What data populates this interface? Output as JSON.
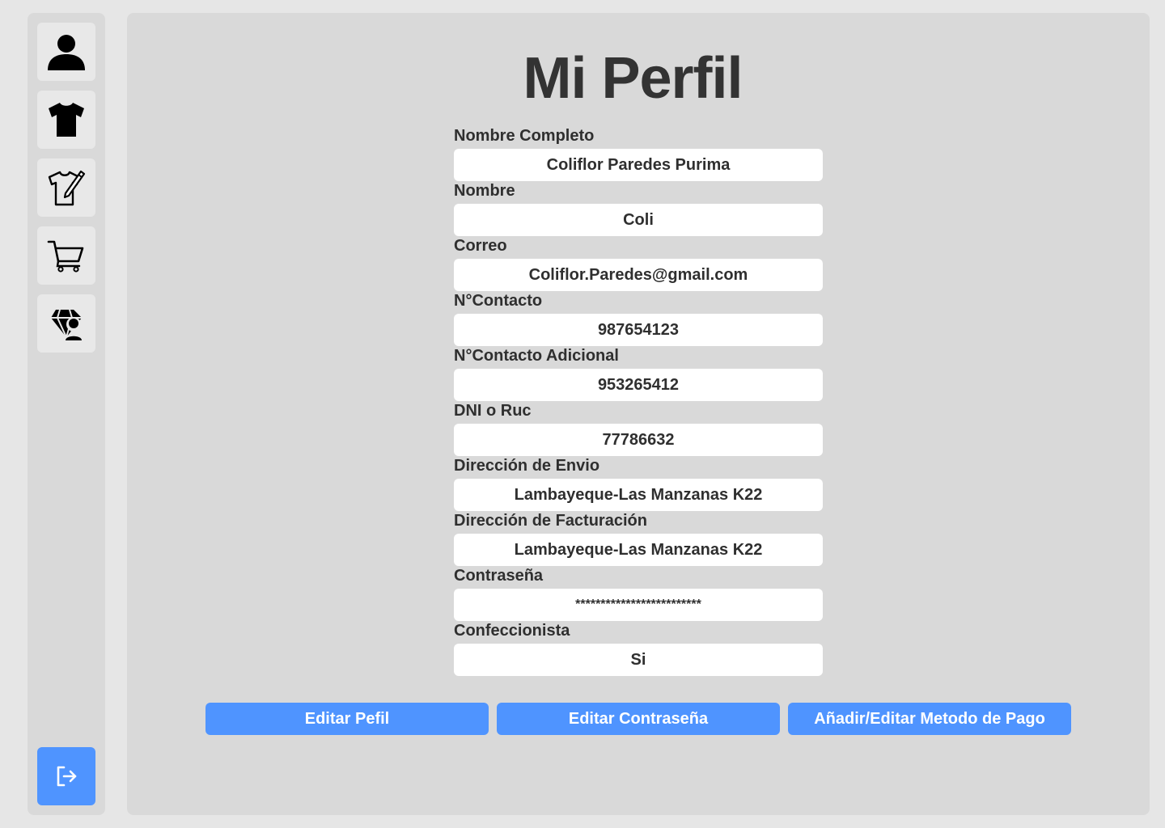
{
  "sidebar": {
    "items": [
      {
        "icon": "user-icon"
      },
      {
        "icon": "tshirt-icon"
      },
      {
        "icon": "tshirt-design-icon"
      },
      {
        "icon": "cart-icon"
      },
      {
        "icon": "diamond-user-icon"
      }
    ],
    "logout_icon": "logout-icon"
  },
  "title": "Mi Perfil",
  "fields": [
    {
      "label": "Nombre Completo",
      "value": "Coliflor Paredes Purima"
    },
    {
      "label": "Nombre",
      "value": "Coli"
    },
    {
      "label": "Correo",
      "value": "Coliflor.Paredes@gmail.com"
    },
    {
      "label": "N°Contacto",
      "value": "987654123"
    },
    {
      "label": "N°Contacto Adicional",
      "value": "953265412"
    },
    {
      "label": "DNI o Ruc",
      "value": "77786632"
    },
    {
      "label": "Dirección de Envio",
      "value": "Lambayeque-Las Manzanas K22"
    },
    {
      "label": "Dirección de Facturación",
      "value": "Lambayeque-Las Manzanas K22"
    },
    {
      "label": "Contraseña",
      "value": "*************************"
    },
    {
      "label": "Confeccionista",
      "value": "Si"
    }
  ],
  "buttons": {
    "edit_profile": "Editar Pefil",
    "edit_password": "Editar Contraseña",
    "payment_method": "Añadir/Editar Metodo de Pago"
  },
  "colors": {
    "accent": "#4f94ff",
    "panel": "#d9d9d9",
    "background": "#e6e6e6",
    "text": "#333333"
  }
}
